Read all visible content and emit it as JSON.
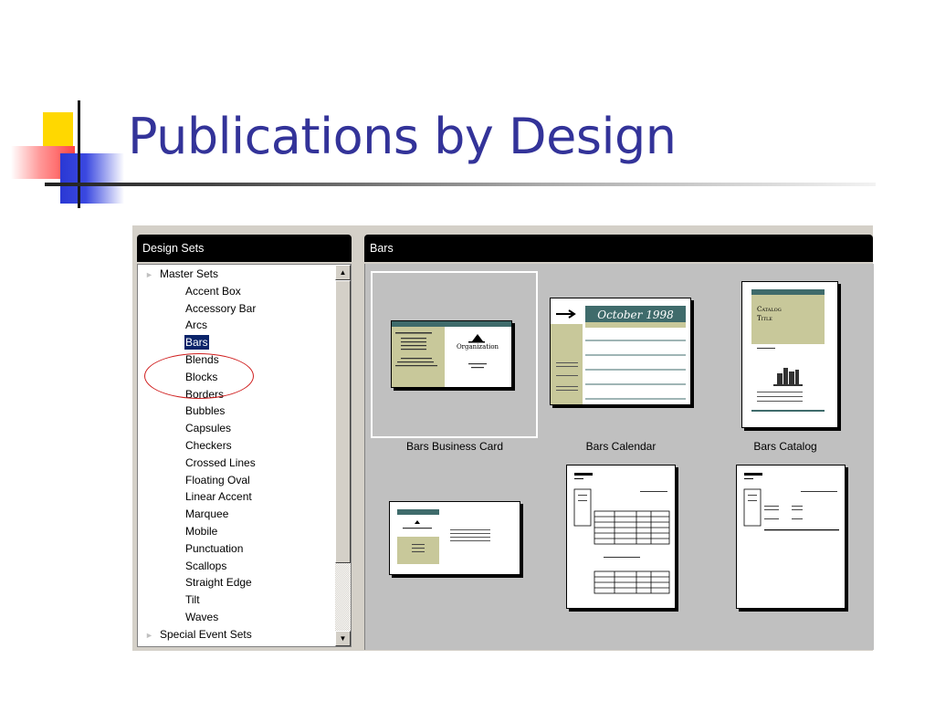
{
  "slide": {
    "title": "Publications by Design"
  },
  "design_sets": {
    "header": "Design Sets",
    "groups": [
      {
        "label": "Master Sets",
        "expanded": true,
        "items": [
          "Accent Box",
          "Accessory Bar",
          "Arcs",
          "Bars",
          "Blends",
          "Blocks",
          "Borders",
          "Bubbles",
          "Capsules",
          "Checkers",
          "Crossed Lines",
          "Floating Oval",
          "Linear Accent",
          "Marquee",
          "Mobile",
          "Punctuation",
          "Scallops",
          "Straight Edge",
          "Tilt",
          "Waves"
        ]
      },
      {
        "label": "Special Event Sets",
        "expanded": false,
        "items": []
      }
    ],
    "selected": "Bars",
    "highlighted": "Arcs"
  },
  "gallery": {
    "header": "Bars",
    "tiles": [
      {
        "label": "Bars Business Card",
        "selected": true
      },
      {
        "label": "Bars Calendar",
        "selected": false
      },
      {
        "label": "Bars Catalog",
        "selected": false
      },
      {
        "label": "",
        "selected": false
      },
      {
        "label": "",
        "selected": false
      },
      {
        "label": "",
        "selected": false
      }
    ],
    "thumb_text": {
      "card_org": "Organization",
      "calendar_title": "October 1998",
      "catalog_title_1": "Catalog",
      "catalog_title_2": "Title"
    }
  },
  "colors": {
    "title": "#333399",
    "header_bg": "#000000",
    "selection": "#0a246a",
    "accent_teal": "#3f6b6b",
    "accent_olive": "#c8c89a",
    "annotation": "#d02020"
  },
  "icons": {
    "group_arrow": "triangle-right-icon",
    "scroll_up": "arrow-up-icon",
    "scroll_down": "arrow-down-icon"
  }
}
